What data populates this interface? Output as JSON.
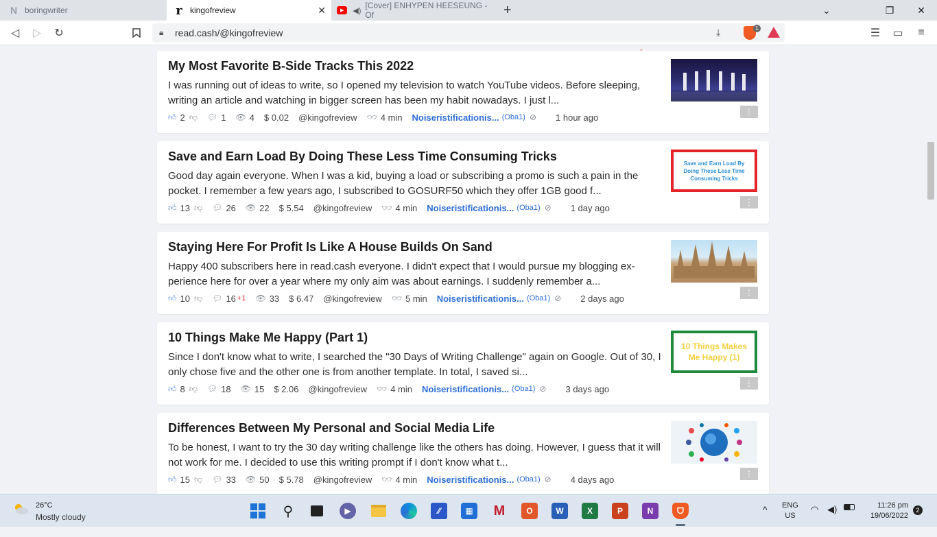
{
  "browser": {
    "tabs": [
      {
        "title": "boringwriter",
        "favicon": "N",
        "active": false
      },
      {
        "title": "kingofreview",
        "favicon": "r",
        "active": true
      },
      {
        "title": "[Cover] ENHYPEN HEESEUNG - Of",
        "favicon": "youtube",
        "active": false
      }
    ],
    "url": "read.cash/@kingofreview",
    "shield_count": "1"
  },
  "articles": [
    {
      "title": "My Most Favorite B-Side Tracks This 2022",
      "excerpt": "I was running out of ideas to write, so I opened my television to watch YouTube videos. Before sleeping, writing an article and watching in bigger screen has been my habit nowadays. I just l...",
      "likes": "2",
      "comments": "1",
      "comments_new": "",
      "views": "4",
      "earned": "$ 0.02",
      "author": "@kingofreview",
      "read_time": "4 min",
      "community": "Noiseristificationis...",
      "community_tag": "(Oba1)",
      "posted": "1 hour ago",
      "thumb": "stage-performance"
    },
    {
      "title": "Save and Earn Load By Doing These Less Time Consuming Tricks",
      "excerpt": "Good day again everyone. When I was a kid, buying a load or subscribing a promo is such a pain in the pocket. I remember a few years ago, I subscribed to GOSURF50 which they offer 1GB good f...",
      "likes": "13",
      "comments": "26",
      "comments_new": "",
      "views": "22",
      "earned": "$ 5.54",
      "author": "@kingofreview",
      "read_time": "4 min",
      "community": "Noiseristificationis...",
      "community_tag": "(Oba1)",
      "posted": "1 day ago",
      "thumb": "text-red",
      "thumb_text": "Save and Earn Load By Doing These Less Time Consuming Tricks"
    },
    {
      "title": "Staying Here For Profit Is Like A House Builds On Sand",
      "excerpt": "Happy 400 subscribers here in read.cash everyone. I didn't expect that I would pursue my blogging ex-perience here for over a year where my only aim was about earnings. I suddenly remember a...",
      "likes": "10",
      "comments": "16",
      "comments_new": "+1",
      "views": "33",
      "earned": "$ 6.47",
      "author": "@kingofreview",
      "read_time": "5 min",
      "community": "Noiseristificationis...",
      "community_tag": "(Oba1)",
      "posted": "2 days ago",
      "thumb": "sand-castle"
    },
    {
      "title": "10 Things Make Me Happy (Part 1)",
      "excerpt": "Since I don't know what to write, I searched the \"30 Days of Writing Challenge\" again on Google. Out of 30, I only chose five and the other one is from another template. In total, I saved si...",
      "likes": "8",
      "comments": "18",
      "comments_new": "",
      "views": "15",
      "earned": "$ 2.06",
      "author": "@kingofreview",
      "read_time": "4 min",
      "community": "Noiseristificationis...",
      "community_tag": "(Oba1)",
      "posted": "3 days ago",
      "thumb": "text-green",
      "thumb_text": "10 Things Makes Me Happy (1)"
    },
    {
      "title": "Differences Between My Personal and Social Media Life",
      "excerpt": "To be honest, I want to try the 30 day writing challenge like the others has doing. However, I guess that it will not work for me. I decided to use this writing prompt if I don't know what t...",
      "likes": "15",
      "comments": "33",
      "comments_new": "",
      "views": "50",
      "earned": "$ 5.78",
      "author": "@kingofreview",
      "read_time": "4 min",
      "community": "Noiseristificationis...",
      "community_tag": "(Oba1)",
      "posted": "4 days ago",
      "thumb": "social-globe"
    }
  ],
  "taskbar": {
    "temperature": "26°C",
    "condition": "Mostly cloudy",
    "language": "ENG",
    "region": "US",
    "time": "11:26 pm",
    "date": "19/06/2022",
    "notifications": "2"
  },
  "colors": {
    "accent_blue": "#2f6fd6",
    "icon_blue": "#4f86d9",
    "brave_orange": "#f15a22",
    "thumb_red": "#e5242a",
    "thumb_green": "#1f8a3b"
  }
}
